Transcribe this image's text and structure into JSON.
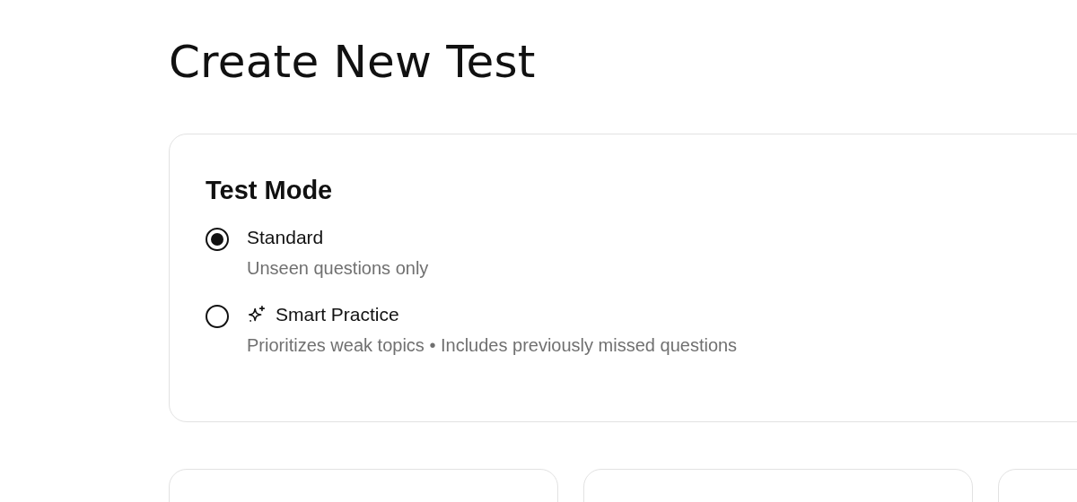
{
  "title": "Create New Test",
  "test_mode": {
    "heading": "Test Mode",
    "options": [
      {
        "kind": "plain",
        "label": "Standard",
        "description": "Unseen questions only",
        "selected": true
      },
      {
        "kind": "sparkle",
        "label": "Smart Practice",
        "description": "Prioritizes weak topics • Includes previously missed questions",
        "selected": false
      }
    ]
  }
}
